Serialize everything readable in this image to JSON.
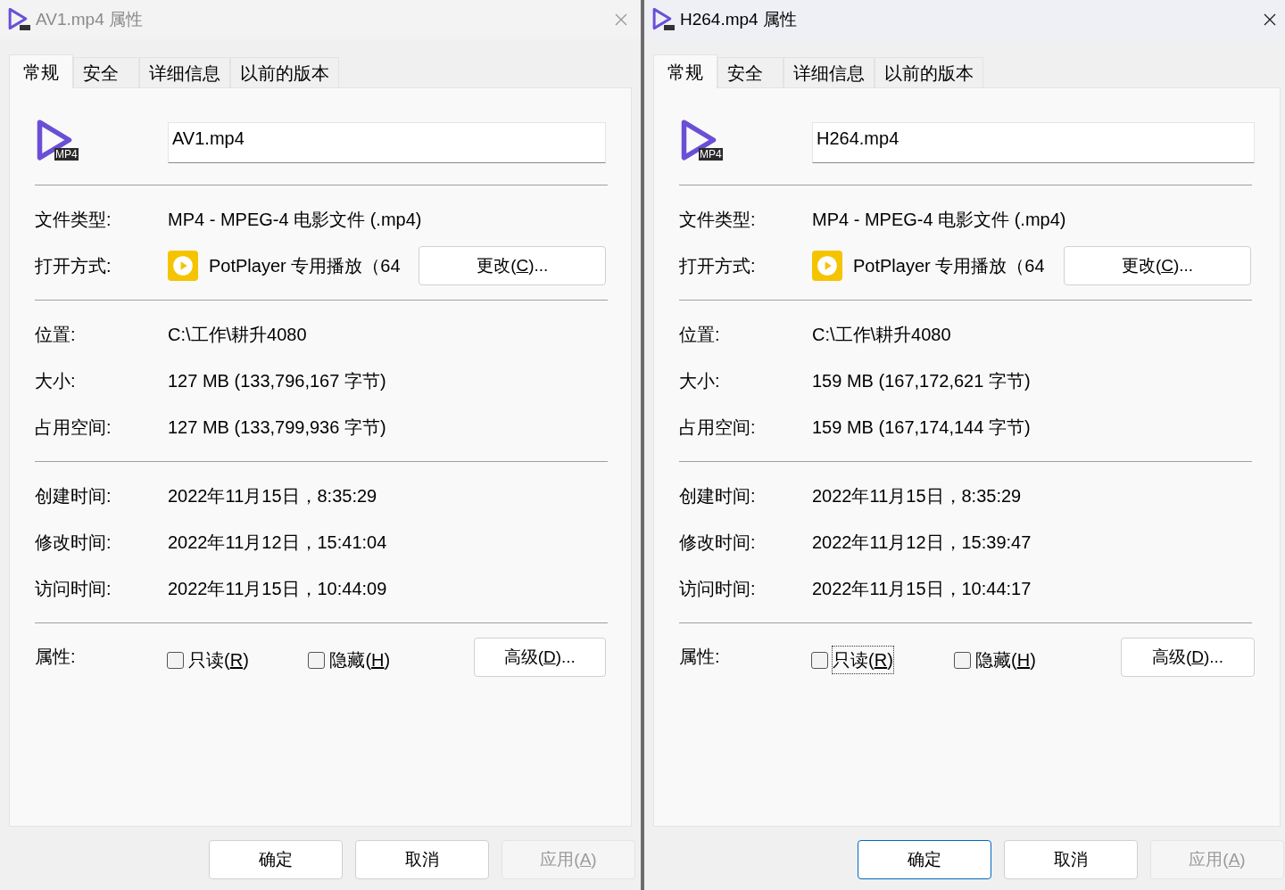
{
  "windows": [
    {
      "title": "AV1.mp4 属性",
      "active": false,
      "tabs": [
        {
          "label": "常规",
          "selected": true
        },
        {
          "label": "安全",
          "selected": false
        },
        {
          "label": "详细信息",
          "selected": false
        },
        {
          "label": "以前的版本",
          "selected": false
        }
      ],
      "icon_badge": "MP4",
      "file_name": "AV1.mp4",
      "sections": [
        [
          {
            "kind": "text",
            "label": "文件类型:",
            "value": "MP4 - MPEG-4 电影文件 (.mp4)"
          },
          {
            "kind": "open_with",
            "label": "打开方式:",
            "value": "PotPlayer 专用播放（64",
            "button": {
              "before": "更改(",
              "key": "C",
              "after": ")..."
            }
          }
        ],
        [
          {
            "kind": "text",
            "label": "位置:",
            "value": "C:\\工作\\耕升4080"
          },
          {
            "kind": "text",
            "label": "大小:",
            "value": "127 MB (133,796,167 字节)"
          },
          {
            "kind": "text",
            "label": "占用空间:",
            "value": "127 MB (133,799,936 字节)"
          }
        ],
        [
          {
            "kind": "text",
            "label": "创建时间:",
            "value": "2022年11月15日，8:35:29"
          },
          {
            "kind": "text",
            "label": "修改时间:",
            "value": "2022年11月12日，15:41:04"
          },
          {
            "kind": "text",
            "label": "访问时间:",
            "value": "2022年11月15日，10:44:09"
          }
        ],
        [
          {
            "kind": "attributes",
            "label": "属性:",
            "checkboxes": [
              {
                "before": "只读(",
                "key": "R",
                "after": ")",
                "checked": false,
                "focused": false
              },
              {
                "before": "隐藏(",
                "key": "H",
                "after": ")",
                "checked": false,
                "focused": false
              }
            ],
            "button": {
              "before": "高级(",
              "key": "D",
              "after": ")..."
            }
          }
        ]
      ],
      "buttons": [
        {
          "before": "确定",
          "focused": false,
          "disabled": false
        },
        {
          "before": "取消",
          "focused": false,
          "disabled": false
        },
        {
          "before": "应用(",
          "key": "A",
          "after": ")",
          "focused": false,
          "disabled": true
        }
      ]
    },
    {
      "title": "H264.mp4 属性",
      "active": true,
      "tabs": [
        {
          "label": "常规",
          "selected": true
        },
        {
          "label": "安全",
          "selected": false
        },
        {
          "label": "详细信息",
          "selected": false
        },
        {
          "label": "以前的版本",
          "selected": false
        }
      ],
      "icon_badge": "MP4",
      "file_name": "H264.mp4",
      "sections": [
        [
          {
            "kind": "text",
            "label": "文件类型:",
            "value": "MP4 - MPEG-4 电影文件 (.mp4)"
          },
          {
            "kind": "open_with",
            "label": "打开方式:",
            "value": "PotPlayer 专用播放（64",
            "button": {
              "before": "更改(",
              "key": "C",
              "after": ")..."
            }
          }
        ],
        [
          {
            "kind": "text",
            "label": "位置:",
            "value": "C:\\工作\\耕升4080"
          },
          {
            "kind": "text",
            "label": "大小:",
            "value": "159 MB (167,172,621 字节)"
          },
          {
            "kind": "text",
            "label": "占用空间:",
            "value": "159 MB (167,174,144 字节)"
          }
        ],
        [
          {
            "kind": "text",
            "label": "创建时间:",
            "value": "2022年11月15日，8:35:29"
          },
          {
            "kind": "text",
            "label": "修改时间:",
            "value": "2022年11月12日，15:39:47"
          },
          {
            "kind": "text",
            "label": "访问时间:",
            "value": "2022年11月15日，10:44:17"
          }
        ],
        [
          {
            "kind": "attributes",
            "label": "属性:",
            "checkboxes": [
              {
                "before": "只读(",
                "key": "R",
                "after": ")",
                "checked": false,
                "focused": true
              },
              {
                "before": "隐藏(",
                "key": "H",
                "after": ")",
                "checked": false,
                "focused": false
              }
            ],
            "button": {
              "before": "高级(",
              "key": "D",
              "after": ")..."
            }
          }
        ]
      ],
      "buttons": [
        {
          "before": "确定",
          "focused": true,
          "disabled": false
        },
        {
          "before": "取消",
          "focused": false,
          "disabled": false
        },
        {
          "before": "应用(",
          "key": "A",
          "after": ")",
          "focused": false,
          "disabled": true
        }
      ]
    }
  ]
}
